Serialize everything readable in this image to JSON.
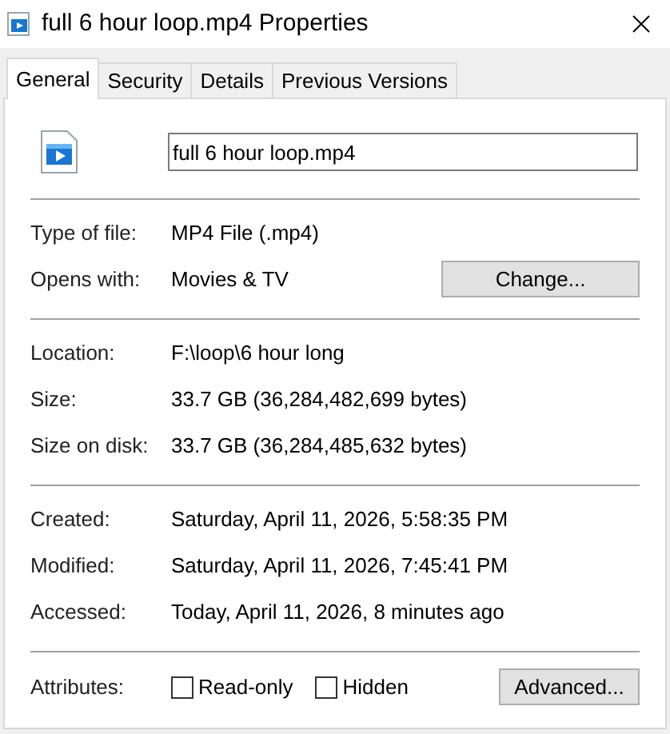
{
  "window": {
    "title": "full 6 hour loop.mp4 Properties"
  },
  "tabs": [
    {
      "label": "General",
      "selected": true
    },
    {
      "label": "Security",
      "selected": false
    },
    {
      "label": "Details",
      "selected": false
    },
    {
      "label": "Previous Versions",
      "selected": false
    }
  ],
  "file_name": "full 6 hour loop.mp4",
  "sections": [
    [
      {
        "label": "Type of file:",
        "value": "MP4 File (.mp4)"
      },
      {
        "label": "Opens with:",
        "value": "Movies & TV",
        "button": "Change..."
      }
    ],
    [
      {
        "label": "Location:",
        "value": "F:\\loop\\6 hour long"
      },
      {
        "label": "Size:",
        "value": "33.7 GB (36,284,482,699 bytes)"
      },
      {
        "label": "Size on disk:",
        "value": "33.7 GB (36,284,485,632 bytes)"
      }
    ],
    [
      {
        "label": "Created:",
        "value": "Saturday, April 11, 2026, 5:58:35 PM"
      },
      {
        "label": "Modified:",
        "value": "Saturday, April 11, 2026, 7:45:41 PM"
      },
      {
        "label": "Accessed:",
        "value": "Today, April 11, 2026, 8 minutes ago"
      }
    ]
  ],
  "attributes": {
    "label": "Attributes:",
    "checkboxes": [
      {
        "label": "Read-only",
        "checked": false
      },
      {
        "label": "Hidden",
        "checked": false
      }
    ],
    "button": "Advanced..."
  }
}
